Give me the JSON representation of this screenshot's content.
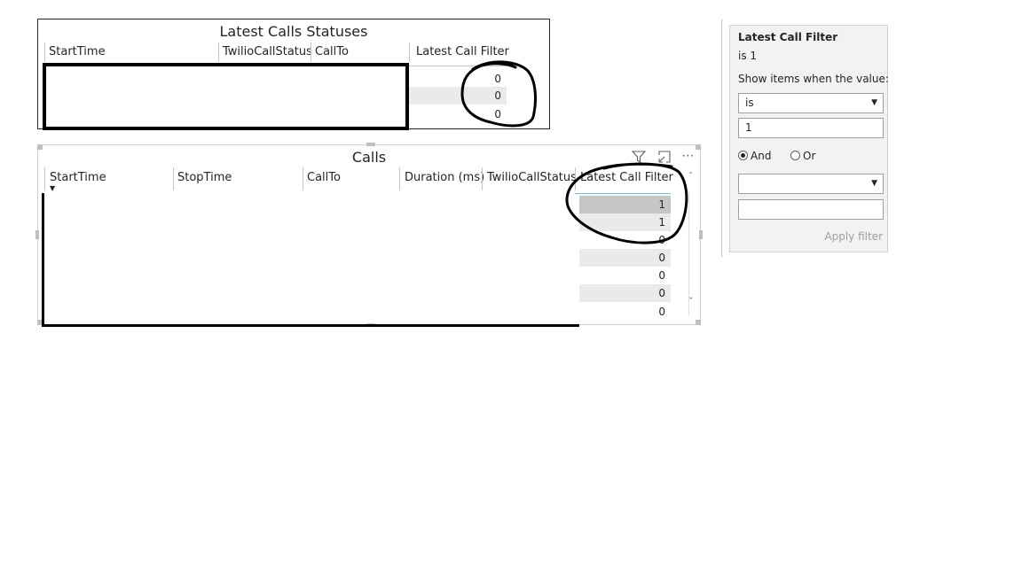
{
  "latest_calls": {
    "title": "Latest Calls Statuses",
    "columns": [
      "StartTime",
      "TwilioCallStatus",
      "CallTo",
      "Latest Call Filter"
    ],
    "filter_values": [
      "0",
      "0",
      "0"
    ]
  },
  "calls": {
    "title": "Calls",
    "columns": [
      "StartTime",
      "StopTime",
      "CallTo",
      "Duration (ms)",
      "TwilioCallStatus",
      "Latest Call Filter"
    ],
    "filter_values": [
      "1",
      "1",
      "0",
      "0",
      "0",
      "0",
      "0"
    ],
    "icons": [
      "filter-icon",
      "focus-mode-icon",
      "more-options-icon"
    ]
  },
  "filter_card": {
    "title": "Latest Call Filter",
    "summary": "is 1",
    "instruction": "Show items when the value:",
    "operator1": "is",
    "value1": "1",
    "logic_and": "And",
    "logic_or": "Or",
    "logic_selected": "And",
    "operator2": "",
    "value2": "",
    "apply_label": "Apply filter"
  }
}
